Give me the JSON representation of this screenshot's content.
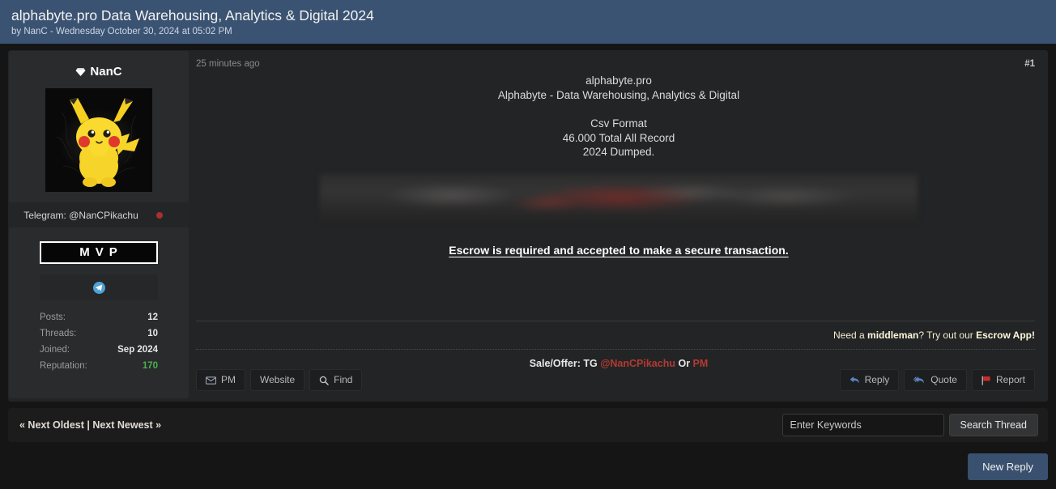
{
  "thread": {
    "title": "alphabyte.pro Data Warehousing, Analytics & Digital 2024",
    "byline": "by NanC - Wednesday October 30, 2024 at 05:02 PM"
  },
  "author": {
    "name": "NanC",
    "rank_badge": "MVP",
    "telegram_label": "Telegram: @NanCPikachu",
    "stats": [
      {
        "label": "Posts:",
        "value": "12"
      },
      {
        "label": "Threads:",
        "value": "10"
      },
      {
        "label": "Joined:",
        "value": "Sep 2024"
      },
      {
        "label": "Reputation:",
        "value": "170"
      }
    ]
  },
  "post": {
    "date": "25 minutes ago",
    "number": "#1",
    "lines": [
      "alphabyte.pro",
      "Alphabyte - Data Warehousing, Analytics & Digital",
      "Csv Format",
      "46.000 Total All Record",
      "2024 Dumped."
    ],
    "escrow_notice": "Escrow is required and accepted to make a secure transaction.",
    "middleman": {
      "prefix": "Need a ",
      "bold1": "middleman",
      "middle": "? Try out our ",
      "bold2": "Escrow App!"
    },
    "sale_offer": {
      "prefix": "Sale/Offer: TG ",
      "handle": "@NanCPikachu",
      "separator": " Or ",
      "pm": "PM"
    },
    "actions_left": [
      {
        "label": "PM",
        "icon": "envelope-icon"
      },
      {
        "label": "Website",
        "icon": "none"
      },
      {
        "label": "Find",
        "icon": "magnifier-icon"
      }
    ],
    "actions_right": [
      {
        "label": "Reply",
        "icon": "reply-arrow-icon"
      },
      {
        "label": "Quote",
        "icon": "quote-arrows-icon"
      },
      {
        "label": "Report",
        "icon": "flag-icon"
      }
    ]
  },
  "navbar": {
    "links": "« Next Oldest | Next Newest »",
    "search_placeholder": "Enter Keywords",
    "search_button": "Search Thread"
  },
  "footer": {
    "new_reply": "New Reply"
  },
  "colors": {
    "header_bg": "#3b5372",
    "reputation": "#4caf50",
    "accent_red": "#b43a33",
    "status_dot": "#a6312f",
    "middleman_text": "#f3edcf",
    "new_reply_bg": "#39506e",
    "telegram_blue": "#4ea2d8"
  }
}
